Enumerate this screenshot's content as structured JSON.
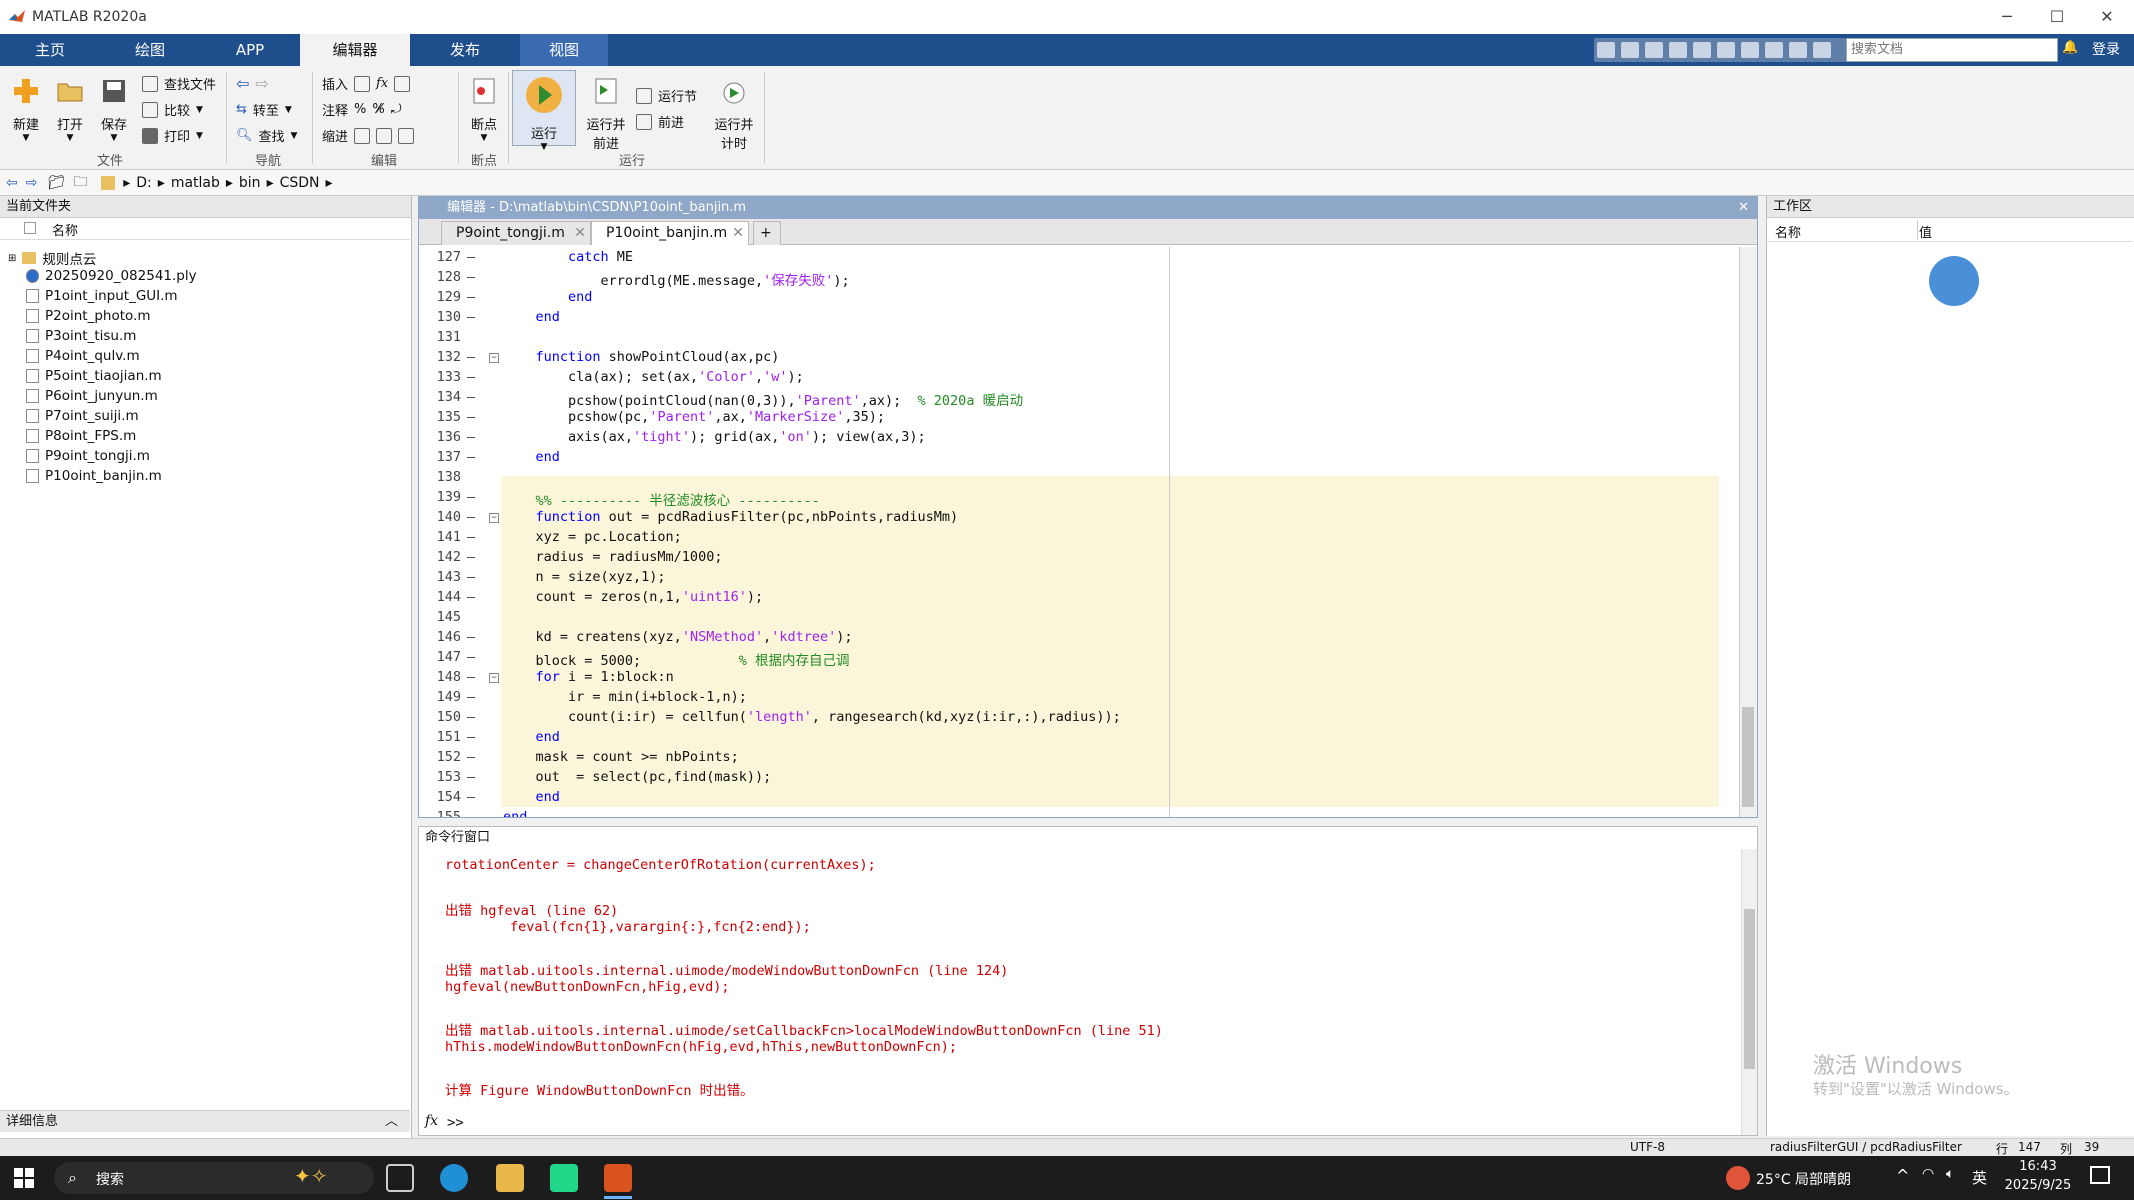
{
  "window": {
    "title": "MATLAB R2020a"
  },
  "ribbon_tabs": [
    "主页",
    "绘图",
    "APP",
    "编辑器",
    "发布",
    "视图"
  ],
  "search_docs_placeholder": "搜索文档",
  "login": "登录",
  "ribbon": {
    "new": "新建",
    "open": "打开",
    "save": "保存",
    "find_files": "查找文件",
    "compare": "比较",
    "print": "打印",
    "group_file": "文件",
    "goto": "转至",
    "find": "查找",
    "group_nav": "导航",
    "insert": "插入",
    "comment": "注释",
    "indent": "缩进",
    "group_edit": "编辑",
    "breakpoints": "断点",
    "group_breakpoints": "断点",
    "run": "运行",
    "run_advance_1": "运行并",
    "run_advance_2": "前进",
    "run_section": "运行节",
    "advance": "前进",
    "run_time_1": "运行并",
    "run_time_2": "计时",
    "group_run": "运行"
  },
  "address": {
    "parts": [
      "D:",
      "matlab",
      "bin",
      "CSDN"
    ]
  },
  "file_panel": {
    "title": "当前文件夹",
    "col_name": "名称",
    "folder": "规则点云",
    "files": [
      "20250920_082541.ply",
      "P1oint_input_GUI.m",
      "P2oint_photo.m",
      "P3oint_tisu.m",
      "P4oint_qulv.m",
      "P5oint_tiaojian.m",
      "P6oint_junyun.m",
      "P7oint_suiji.m",
      "P8oint_FPS.m",
      "P9oint_tongji.m",
      "P10oint_banjin.m"
    ],
    "details": "详细信息"
  },
  "editor": {
    "title": "编辑器 - D:\\matlab\\bin\\CSDN\\P10oint_banjin.m",
    "tabs": [
      "P9oint_tongji.m",
      "P10oint_banjin.m"
    ],
    "lines": [
      {
        "n": "127",
        "t": "        catch ME"
      },
      {
        "n": "128",
        "t": "            errordlg(ME.message,'保存失败');"
      },
      {
        "n": "129",
        "t": "        end"
      },
      {
        "n": "130",
        "t": "    end"
      },
      {
        "n": "131",
        "t": ""
      },
      {
        "n": "132",
        "t": "    function showPointCloud(ax,pc)"
      },
      {
        "n": "133",
        "t": "        cla(ax); set(ax,'Color','w');"
      },
      {
        "n": "134",
        "t": "        pcshow(pointCloud(nan(0,3)),'Parent',ax);  % 2020a 暖启动"
      },
      {
        "n": "135",
        "t": "        pcshow(pc,'Parent',ax,'MarkerSize',35);"
      },
      {
        "n": "136",
        "t": "        axis(ax,'tight'); grid(ax,'on'); view(ax,3);"
      },
      {
        "n": "137",
        "t": "    end"
      },
      {
        "n": "138",
        "t": ""
      },
      {
        "n": "139",
        "t": "    %% ---------- 半径滤波核心 ----------"
      },
      {
        "n": "140",
        "t": "    function out = pcdRadiusFilter(pc,nbPoints,radiusMm)"
      },
      {
        "n": "141",
        "t": "    xyz = pc.Location;"
      },
      {
        "n": "142",
        "t": "    radius = radiusMm/1000;"
      },
      {
        "n": "143",
        "t": "    n = size(xyz,1);"
      },
      {
        "n": "144",
        "t": "    count = zeros(n,1,'uint16');"
      },
      {
        "n": "145",
        "t": ""
      },
      {
        "n": "146",
        "t": "    kd = createns(xyz,'NSMethod','kdtree');"
      },
      {
        "n": "147",
        "t": "    block = 5000;            % 根据内存自己调"
      },
      {
        "n": "148",
        "t": "    for i = 1:block:n"
      },
      {
        "n": "149",
        "t": "        ir = min(i+block-1,n);"
      },
      {
        "n": "150",
        "t": "        count(i:ir) = cellfun('length', rangesearch(kd,xyz(i:ir,:),radius));"
      },
      {
        "n": "151",
        "t": "    end"
      },
      {
        "n": "152",
        "t": "    mask = count >= nbPoints;"
      },
      {
        "n": "153",
        "t": "    out  = select(pc,find(mask));"
      },
      {
        "n": "154",
        "t": "    end"
      },
      {
        "n": "155",
        "t": "end"
      }
    ]
  },
  "command": {
    "title": "命令行窗口",
    "lines": [
      {
        "t": "rotationCenter = changeCenterOfRotation(currentAxes);"
      },
      {
        "t": "出错 hgfeval (line 62)"
      },
      {
        "t": "        feval(fcn{1},varargin{:},fcn{2:end});"
      },
      {
        "t": "出错 matlab.uitools.internal.uimode/modeWindowButtonDownFcn (line 124)"
      },
      {
        "t": "hgfeval(newButtonDownFcn,hFig,evd);"
      },
      {
        "t": "出错 matlab.uitools.internal.uimode/setCallbackFcn>localModeWindowButtonDownFcn (line 51)"
      },
      {
        "t": "hThis.modeWindowButtonDownFcn(hFig,evd,hThis,newButtonDownFcn);"
      },
      {
        "t": "计算 Figure WindowButtonDownFcn 时出错。"
      }
    ],
    "prompt": ">>"
  },
  "workspace": {
    "title": "工作区",
    "col_name": "名称",
    "col_value": "值",
    "watermark1": "激活 Windows",
    "watermark2": "转到\"设置\"以激活 Windows。"
  },
  "status": {
    "encoding": "UTF-8",
    "func": "radiusFilterGUI / pcdRadiusFilter",
    "row_label": "行",
    "row": "147",
    "col_label": "列",
    "col": "39"
  },
  "taskbar": {
    "search": "搜索",
    "weather": "25°C 局部晴朗",
    "lang": "英",
    "time": "16:43",
    "date": "2025/9/25"
  }
}
